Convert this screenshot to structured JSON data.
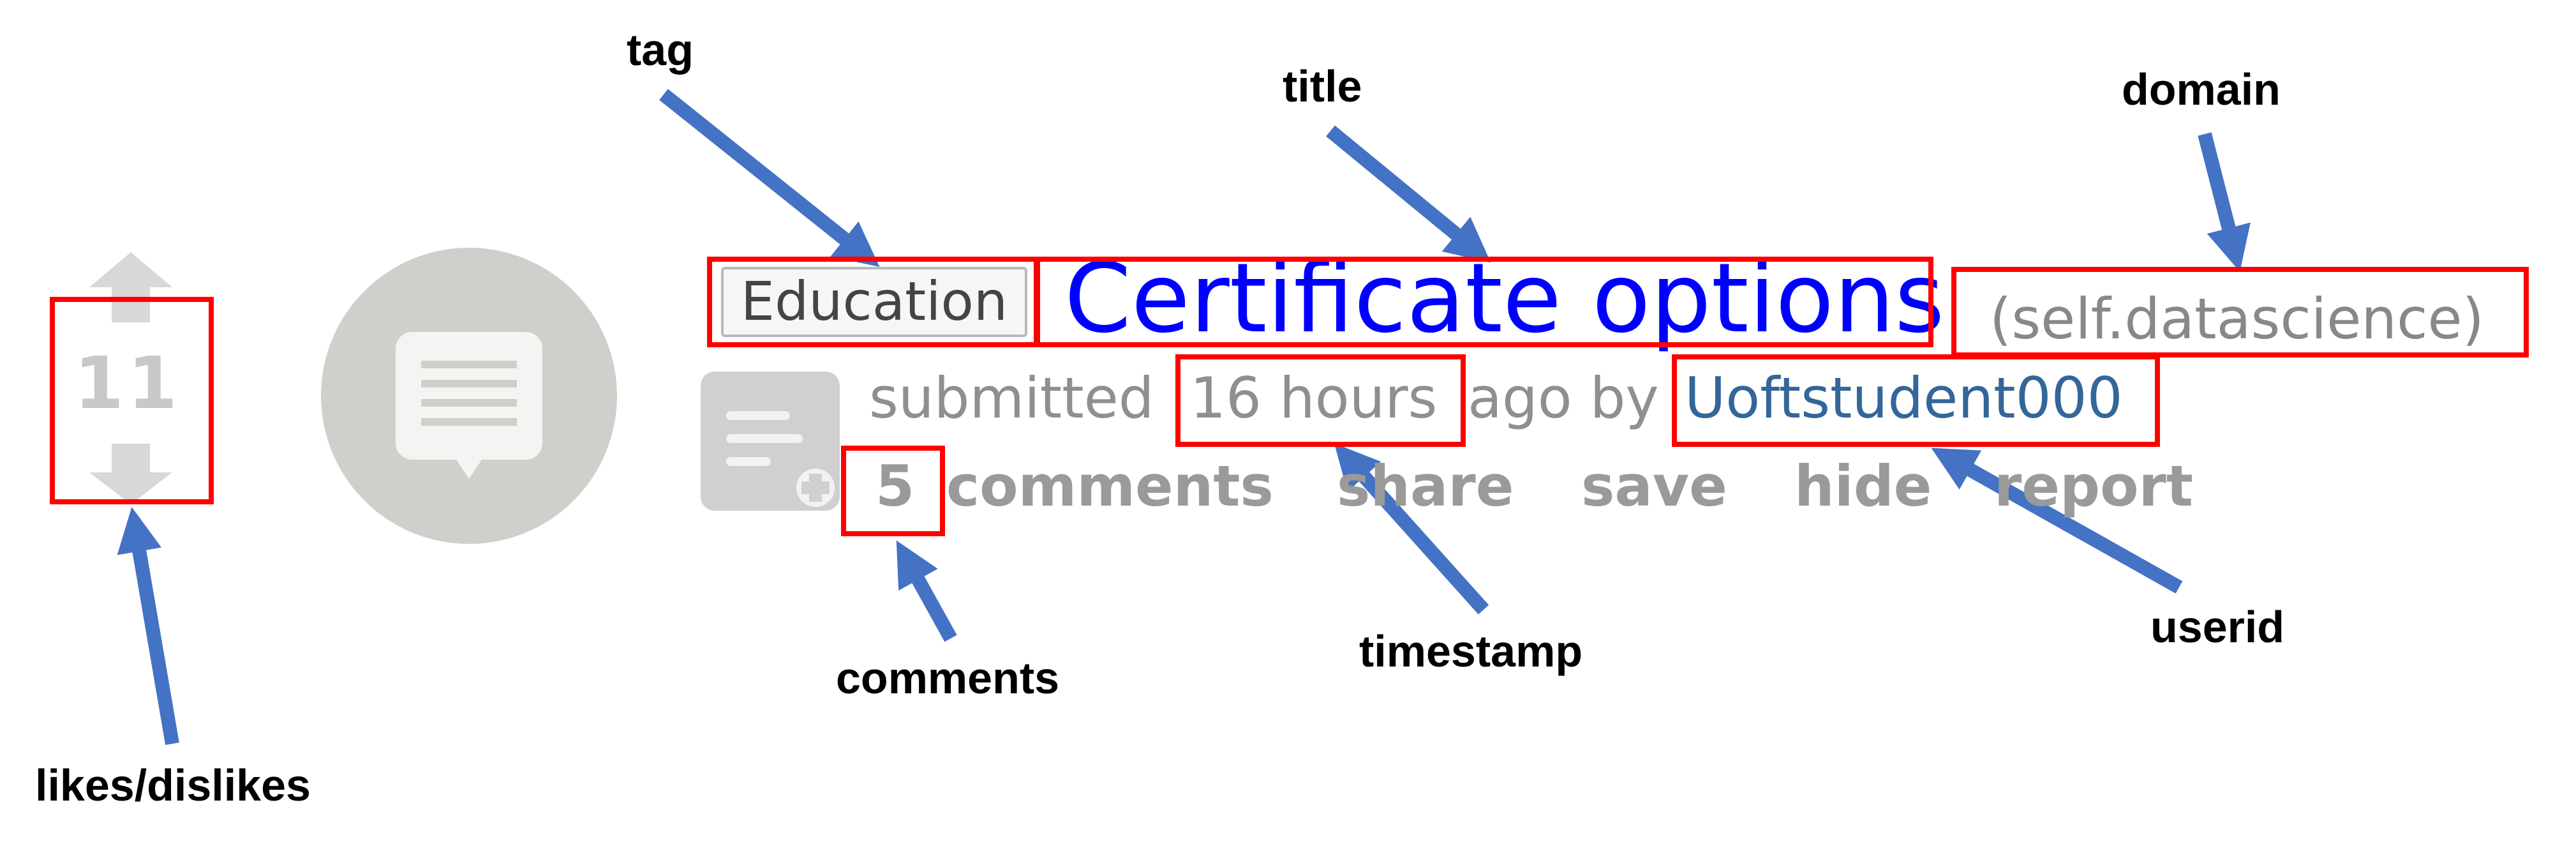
{
  "annotations": {
    "tag": "tag",
    "title": "title",
    "domain": "domain",
    "likes_dislikes": "likes/dislikes",
    "comments": "comments",
    "timestamp": "timestamp",
    "userid": "userid"
  },
  "post": {
    "score": "11",
    "tag": "Education",
    "title": "Certificate options",
    "domain": "(self.datascience)",
    "submitted_prefix": "submitted",
    "timestamp": "16 hours",
    "ago_by": "ago by",
    "author": "Uoftstudent000",
    "comment_count": "5",
    "comments_label": "comments",
    "share": "share",
    "save": "save",
    "hide": "hide",
    "report": "report"
  },
  "icons": {
    "thumbnail": "speech-bubble-icon",
    "expando": "self-text-expand-icon",
    "upvote": "up-arrow-icon",
    "downvote": "down-arrow-icon"
  },
  "colors": {
    "highlight": "#ff0000",
    "arrow": "#4472c4",
    "title_link": "#0000ff",
    "author_link": "#336699",
    "muted": "#8f8f8f"
  }
}
